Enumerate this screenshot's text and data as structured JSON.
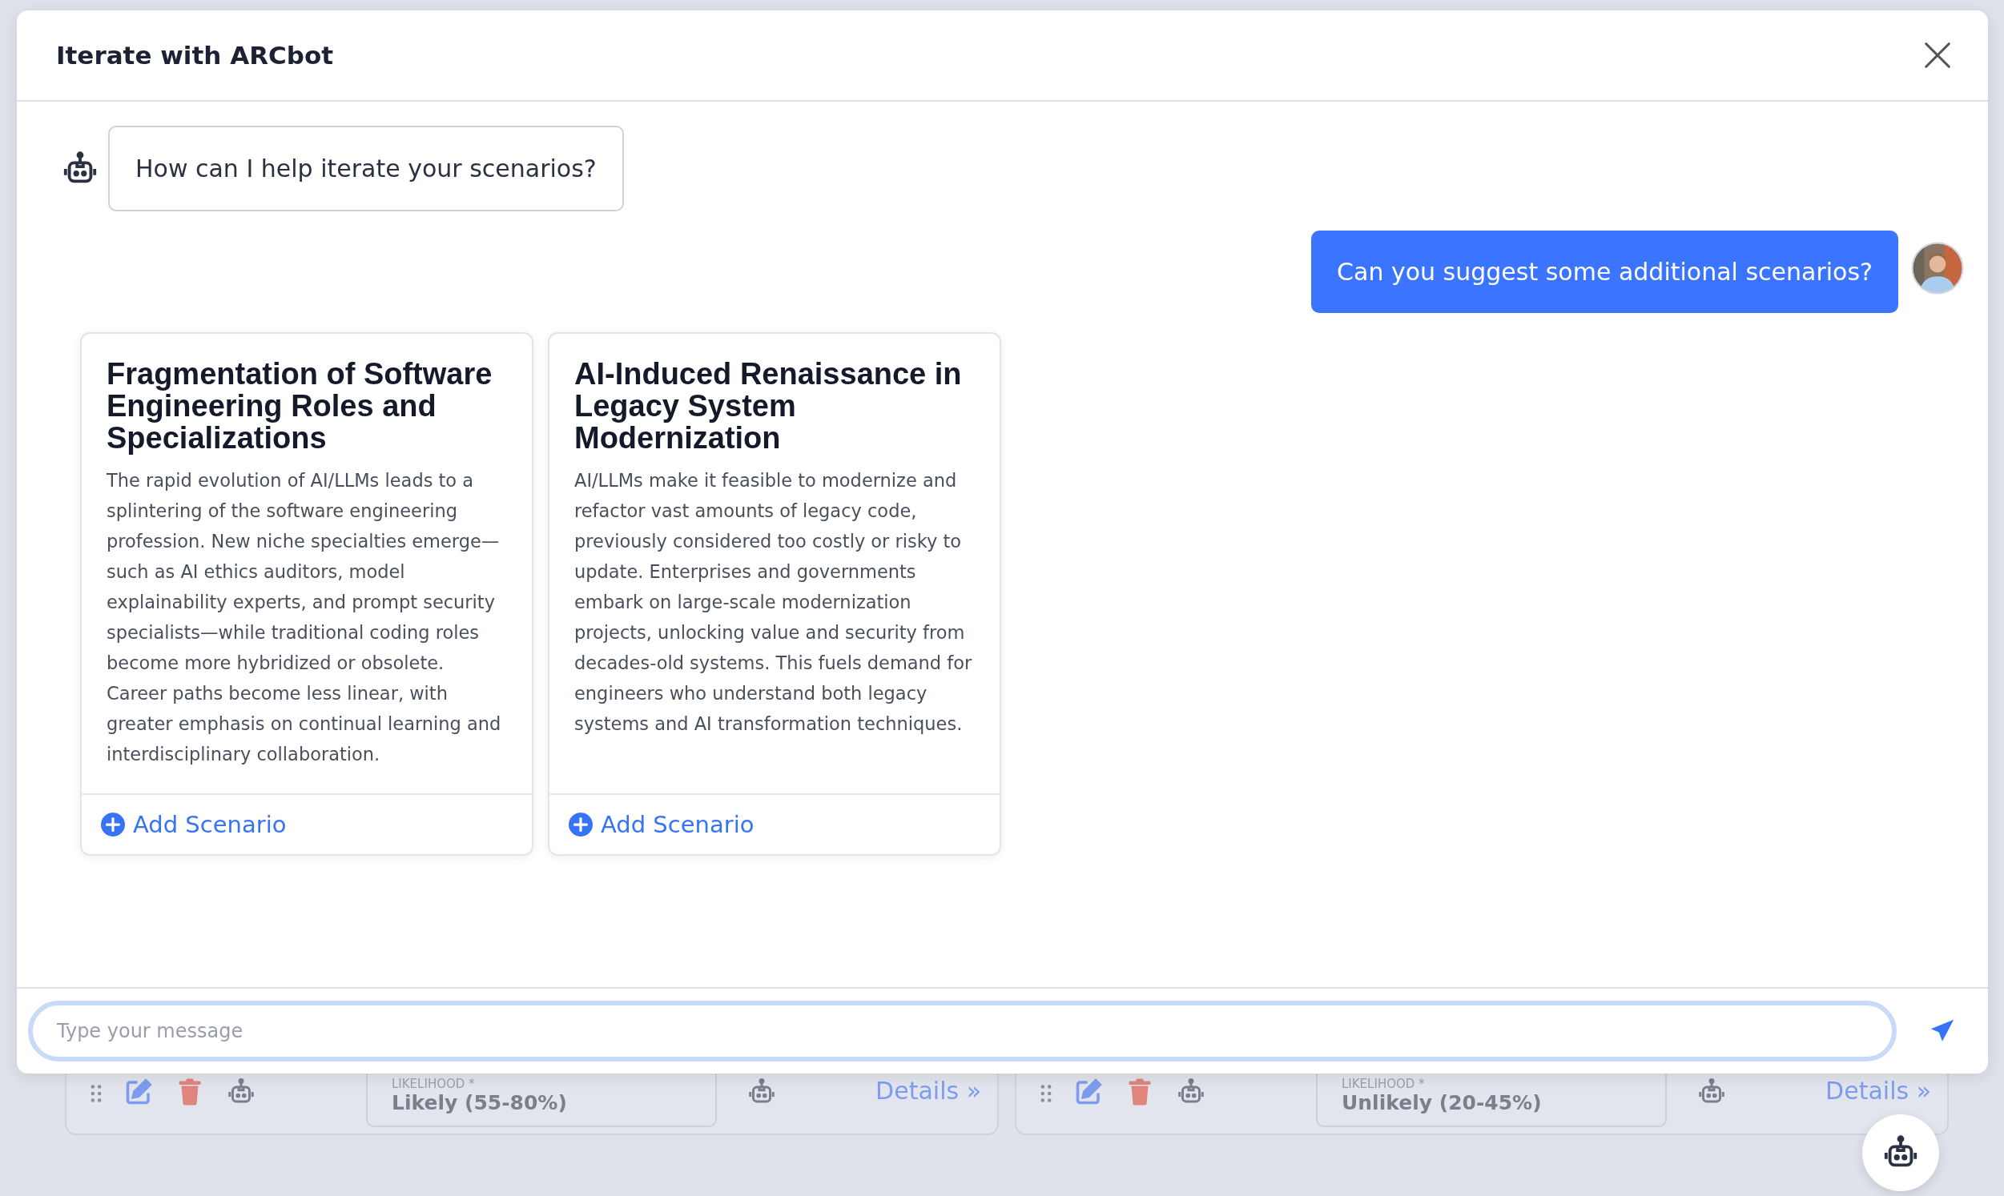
{
  "dialog": {
    "title": "Iterate with ARCbot"
  },
  "messages": [
    {
      "kind": "bot",
      "text": "How can I help iterate your scenarios?"
    },
    {
      "kind": "user",
      "text": "Can you suggest some additional scenarios?"
    }
  ],
  "suggestions": [
    {
      "title": "Fragmentation of Software Engineering Roles and Specializations",
      "body": "The rapid evolution of AI/LLMs leads to a splintering of the software engineering profession. New niche specialties emerge—such as AI ethics auditors, model explainability experts, and prompt security specialists—while traditional coding roles become more hybridized or obsolete. Career paths become less linear, with greater emphasis on continual learning and interdisciplinary collaboration.",
      "action": "Add Scenario"
    },
    {
      "title": "AI-Induced Renaissance in Legacy System Modernization",
      "body": "AI/LLMs make it feasible to modernize and refactor vast amounts of legacy code, previously considered too costly or risky to update. Enterprises and governments embark on large-scale modernization projects, unlocking value and security from decades-old systems. This fuels demand for engineers who understand both legacy systems and AI transformation techniques.",
      "action": "Add Scenario"
    }
  ],
  "composer": {
    "placeholder": "Type your message"
  },
  "background_cards": [
    {
      "likelihood_label": "LIKELIHOOD *",
      "likelihood": "Likely (55-80%)",
      "link": "Details »"
    },
    {
      "likelihood_label": "LIKELIHOOD *",
      "likelihood": "Unlikely (20-45%)",
      "link": "Details »"
    }
  ]
}
